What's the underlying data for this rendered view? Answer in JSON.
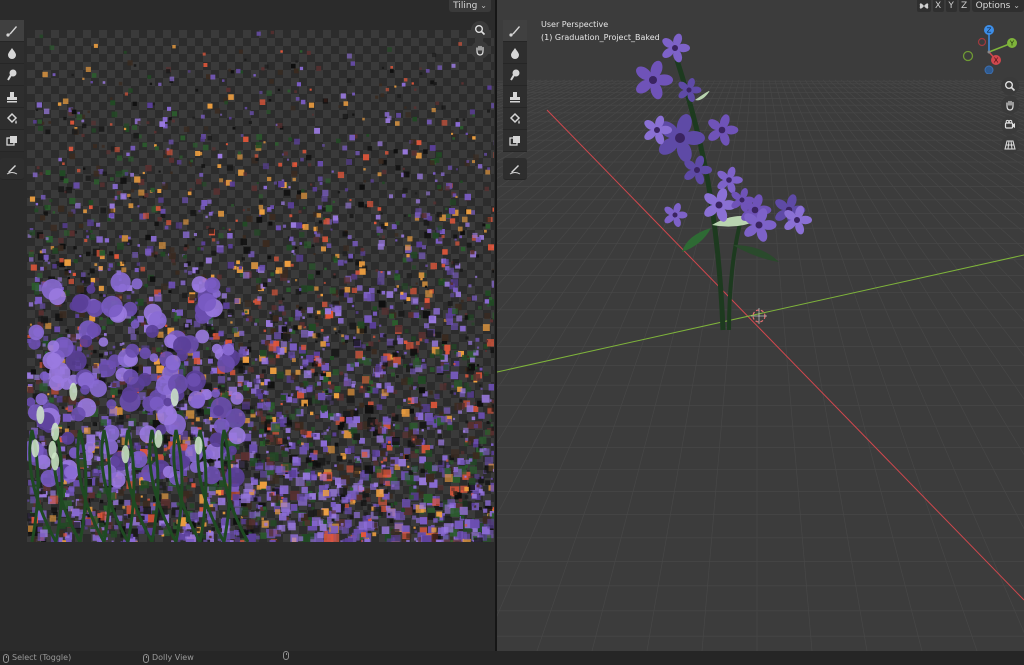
{
  "image_editor": {
    "tiling_label": "Tiling",
    "tools": [
      {
        "icon": "brush-icon"
      },
      {
        "icon": "blur-icon"
      },
      {
        "icon": "smear-icon"
      },
      {
        "icon": "clone-icon"
      },
      {
        "icon": "fill-icon"
      },
      {
        "icon": "mask-icon"
      },
      {
        "icon": "annotate-icon"
      }
    ],
    "nav": [
      {
        "icon": "zoom-icon"
      },
      {
        "icon": "pan-hand-icon"
      }
    ]
  },
  "viewport": {
    "perspective_label": "User Perspective",
    "object_label": "(1) Graduation_Project_Baked",
    "axis_toggles": [
      "X",
      "Y",
      "Z"
    ],
    "options_label": "Options",
    "gizmo": {
      "x": "X",
      "y": "Y",
      "z": "Z"
    },
    "nav": [
      {
        "icon": "zoom-icon"
      },
      {
        "icon": "pan-hand-icon"
      },
      {
        "icon": "camera-icon"
      },
      {
        "icon": "grid-perspective-icon"
      }
    ],
    "colors": {
      "x_axis": "#d0474d",
      "y_axis": "#7fb43b",
      "z_axis": "#3d8ee8",
      "grid_bg": "#3c3c3c"
    }
  },
  "status_bar": {
    "select_label": "Select (Toggle)",
    "dolly_label": "Dolly View"
  },
  "colors": {
    "flower_purple": "#7a5cc4",
    "stem_green": "#214a24",
    "accent_red": "#e0563a"
  }
}
